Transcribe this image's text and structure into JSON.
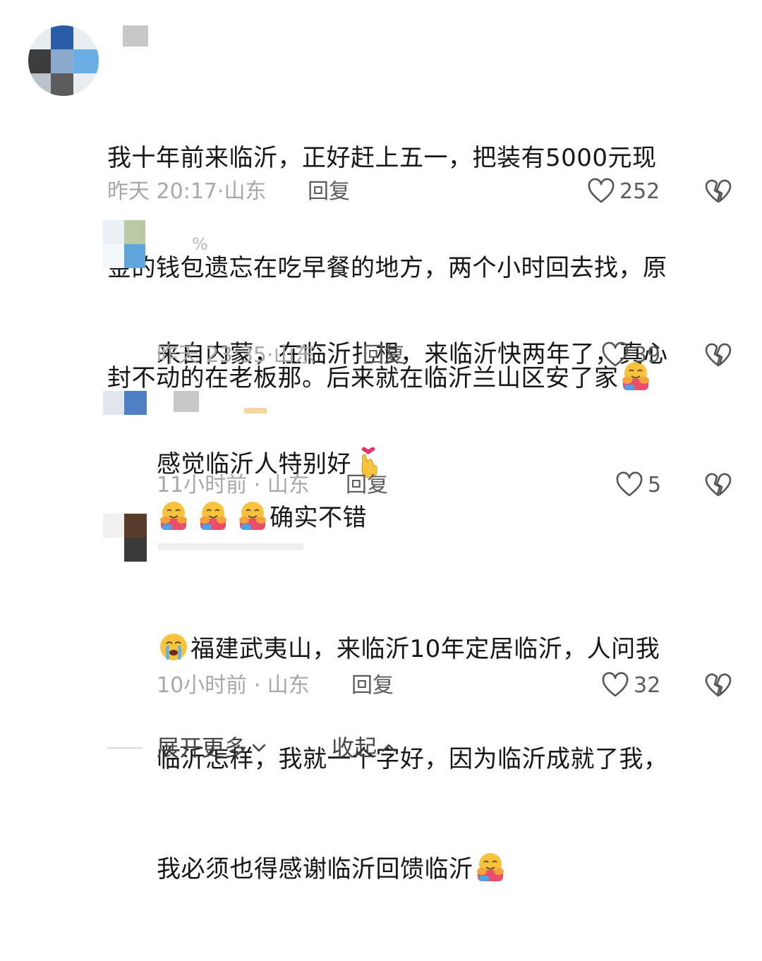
{
  "comments": [
    {
      "text_lines": [
        "我十年前来临沂，正好赶上五一，把装有5000元现",
        "金的钱包遗忘在吃早餐的地方，两个小时回去找，原",
        "封不动的在老板那。后来就在临沂兰山区安了家"
      ],
      "trailing_emoji": "hugging-face-emoji",
      "time": "昨天 20:17",
      "location": "山东",
      "reply_label": "回复",
      "likes": "252"
    },
    {
      "username_hint": "%",
      "text_lines": [
        "来自内蒙，在临沂扎根，来临沂快两年了，真心",
        "感觉临沂人特别好"
      ],
      "trailing_emoji": "finger-heart-emoji",
      "time": "昨天 23:35",
      "location": "山东",
      "reply_label": "回复",
      "likes": "39"
    },
    {
      "leading_emojis": [
        "hugging-face-emoji",
        "hugging-face-emoji",
        "hugging-face-emoji"
      ],
      "text": "确实不错",
      "time": "11小时前",
      "location": "山东",
      "reply_label": "回复",
      "likes": "5"
    },
    {
      "leading_emoji": "loudly-crying-face-emoji",
      "text_lines": [
        "福建武夷山，来临沂10年定居临沂，人问我",
        "临沂怎样，我就一个字好，因为临沂成就了我，",
        "我必须也得感谢临沂回馈临沂"
      ],
      "trailing_emoji": "hugging-face-emoji",
      "time": "10小时前",
      "location": "山东",
      "reply_label": "回复",
      "likes": "32"
    }
  ],
  "footer": {
    "expand_label": "展开更多",
    "collapse_label": "收起"
  },
  "colors": {
    "text": "#161616",
    "meta": "#a8a8a8",
    "action": "#5c5c5c",
    "hug_emoji_yellow": "#f7c23c",
    "hug_emoji_hands": "#f07a4a"
  }
}
